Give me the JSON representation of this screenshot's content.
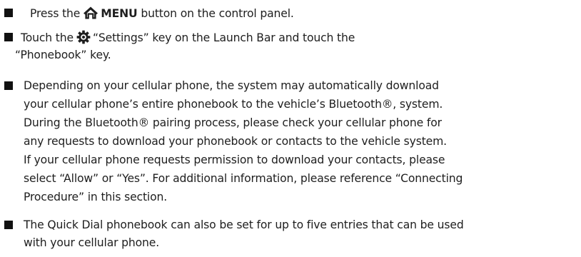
{
  "instructions": [
    {
      "lines": [
        {
          "pre": "Press the",
          "icon": "home-icon",
          "bold": "MENU",
          "post": " button on the control panel."
        }
      ]
    },
    {
      "lines": [
        {
          "pre": "Touch the",
          "icon": "gear-icon",
          "post": "“Settings” key on the Launch Bar and touch the"
        },
        {
          "text": "“Phonebook” key."
        }
      ]
    },
    {
      "lines": [
        {
          "text": "Depending on your cellular phone, the system may automatically download"
        },
        {
          "text": "your cellular phone’s entire phonebook to the vehicle’s Bluetooth®, system."
        },
        {
          "text": "During the Bluetooth® pairing process, please check your cellular phone for"
        },
        {
          "text": "any requests to download your phonebook or contacts to the vehicle system."
        },
        {
          "text": "If your cellular phone requests permission to download your contacts, please"
        },
        {
          "text": "select “Allow” or “Yes”. For additional information, please reference “Connecting"
        },
        {
          "text": "Procedure” in this section."
        }
      ]
    },
    {
      "lines": [
        {
          "text": "The Quick Dial phonebook can also be set for up to five entries that can be used"
        },
        {
          "text": "with your cellular phone."
        }
      ]
    }
  ],
  "colors": {
    "text": "#1e1e1e",
    "bullet": "#111111",
    "background": "#ffffff"
  }
}
